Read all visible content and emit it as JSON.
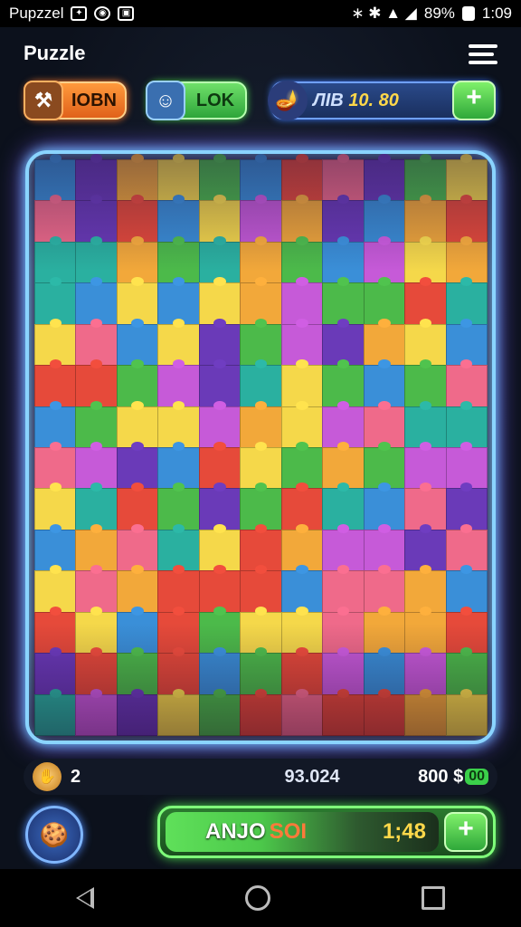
{
  "status_bar": {
    "app_name": "Pupzzel",
    "battery": "89%",
    "time": "1:09"
  },
  "header": {
    "title": "Puzzle"
  },
  "top_pills": {
    "left": {
      "label": "IOBN",
      "icon": "treasure-icon",
      "color": "#e0611a"
    },
    "middle": {
      "label": "LOK",
      "icon": "character-avatar-icon",
      "color": "#2ea53a"
    },
    "right": {
      "label": "ЛІB",
      "value": "10. 80",
      "icon": "genie-lamp-icon",
      "color": "#1a2f5e"
    }
  },
  "board": {
    "palette": [
      "#e64a3a",
      "#f2a83a",
      "#f5d84a",
      "#4cba4a",
      "#3a8fd8",
      "#6a3ab8",
      "#c65ad8",
      "#ef6a8a",
      "#2ab0a0"
    ]
  },
  "stats": {
    "pieces_left": "2",
    "score": "93.024",
    "coins": "800 $",
    "cash_badge": "00"
  },
  "bottom": {
    "left_icon": "cookie-icon",
    "action_label": "ANJO",
    "action_suffix": "SOI",
    "timer": "1;48",
    "plus": "+"
  }
}
